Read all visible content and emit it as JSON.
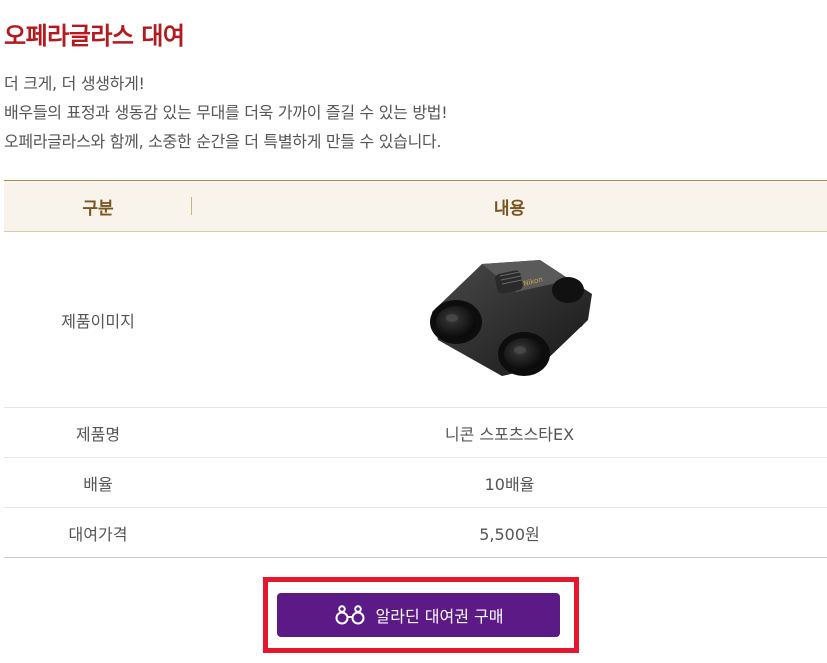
{
  "page": {
    "title": "오페라글라스 대여",
    "intro": [
      "더 크게, 더 생생하게!",
      "배우들의 표정과 생동감 있는 무대를 더욱 가까이 즐길 수 있는 방법!",
      "오페라글라스와 함께, 소중한 순간을 더 특별하게 만들 수 있습니다."
    ]
  },
  "table": {
    "headers": {
      "key": "구분",
      "value": "내용"
    },
    "rows": {
      "image": {
        "label": "제품이미지"
      },
      "name": {
        "label": "제품명",
        "value": "니콘 스포츠스타EX"
      },
      "magnification": {
        "label": "배율",
        "value": "10배율"
      },
      "price": {
        "label": "대여가격",
        "value": "5,500원"
      }
    }
  },
  "buy_button": {
    "label": "알라딘 대여권 구매",
    "icon": "binoculars-icon"
  },
  "colors": {
    "title": "#b3191d",
    "button": "#5b1a85",
    "highlight_frame": "#e6172d"
  }
}
